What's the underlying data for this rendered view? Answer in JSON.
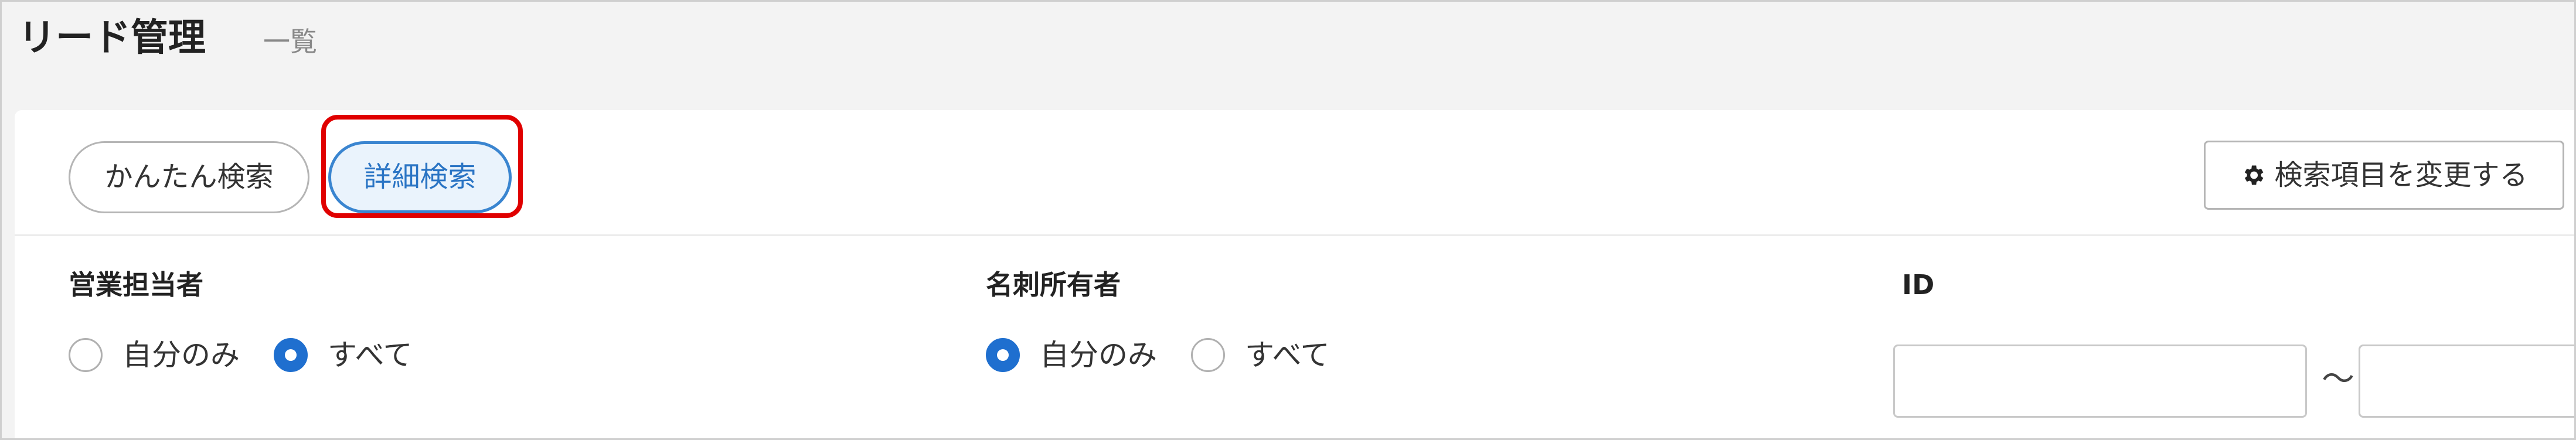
{
  "header": {
    "title": "リード管理",
    "subtitle": "一覧"
  },
  "tabs": [
    {
      "label": "かんたん検索",
      "active": false
    },
    {
      "label": "詳細検索",
      "active": true
    }
  ],
  "settings_button": {
    "label": "検索項目を変更する",
    "icon": "gear-icon"
  },
  "filters": {
    "sales_rep": {
      "label": "営業担当者",
      "options": [
        "自分のみ",
        "すべて"
      ],
      "selected": "すべて"
    },
    "card_owner": {
      "label": "名刺所有者",
      "options": [
        "自分のみ",
        "すべて"
      ],
      "selected": "自分のみ"
    },
    "id": {
      "label": "ID",
      "from_value": "",
      "to_value": "",
      "separator": "～"
    }
  },
  "colors": {
    "accent": "#1f6fcf",
    "highlight": "#e00000",
    "active_tab_bg": "#eaf3fc"
  }
}
